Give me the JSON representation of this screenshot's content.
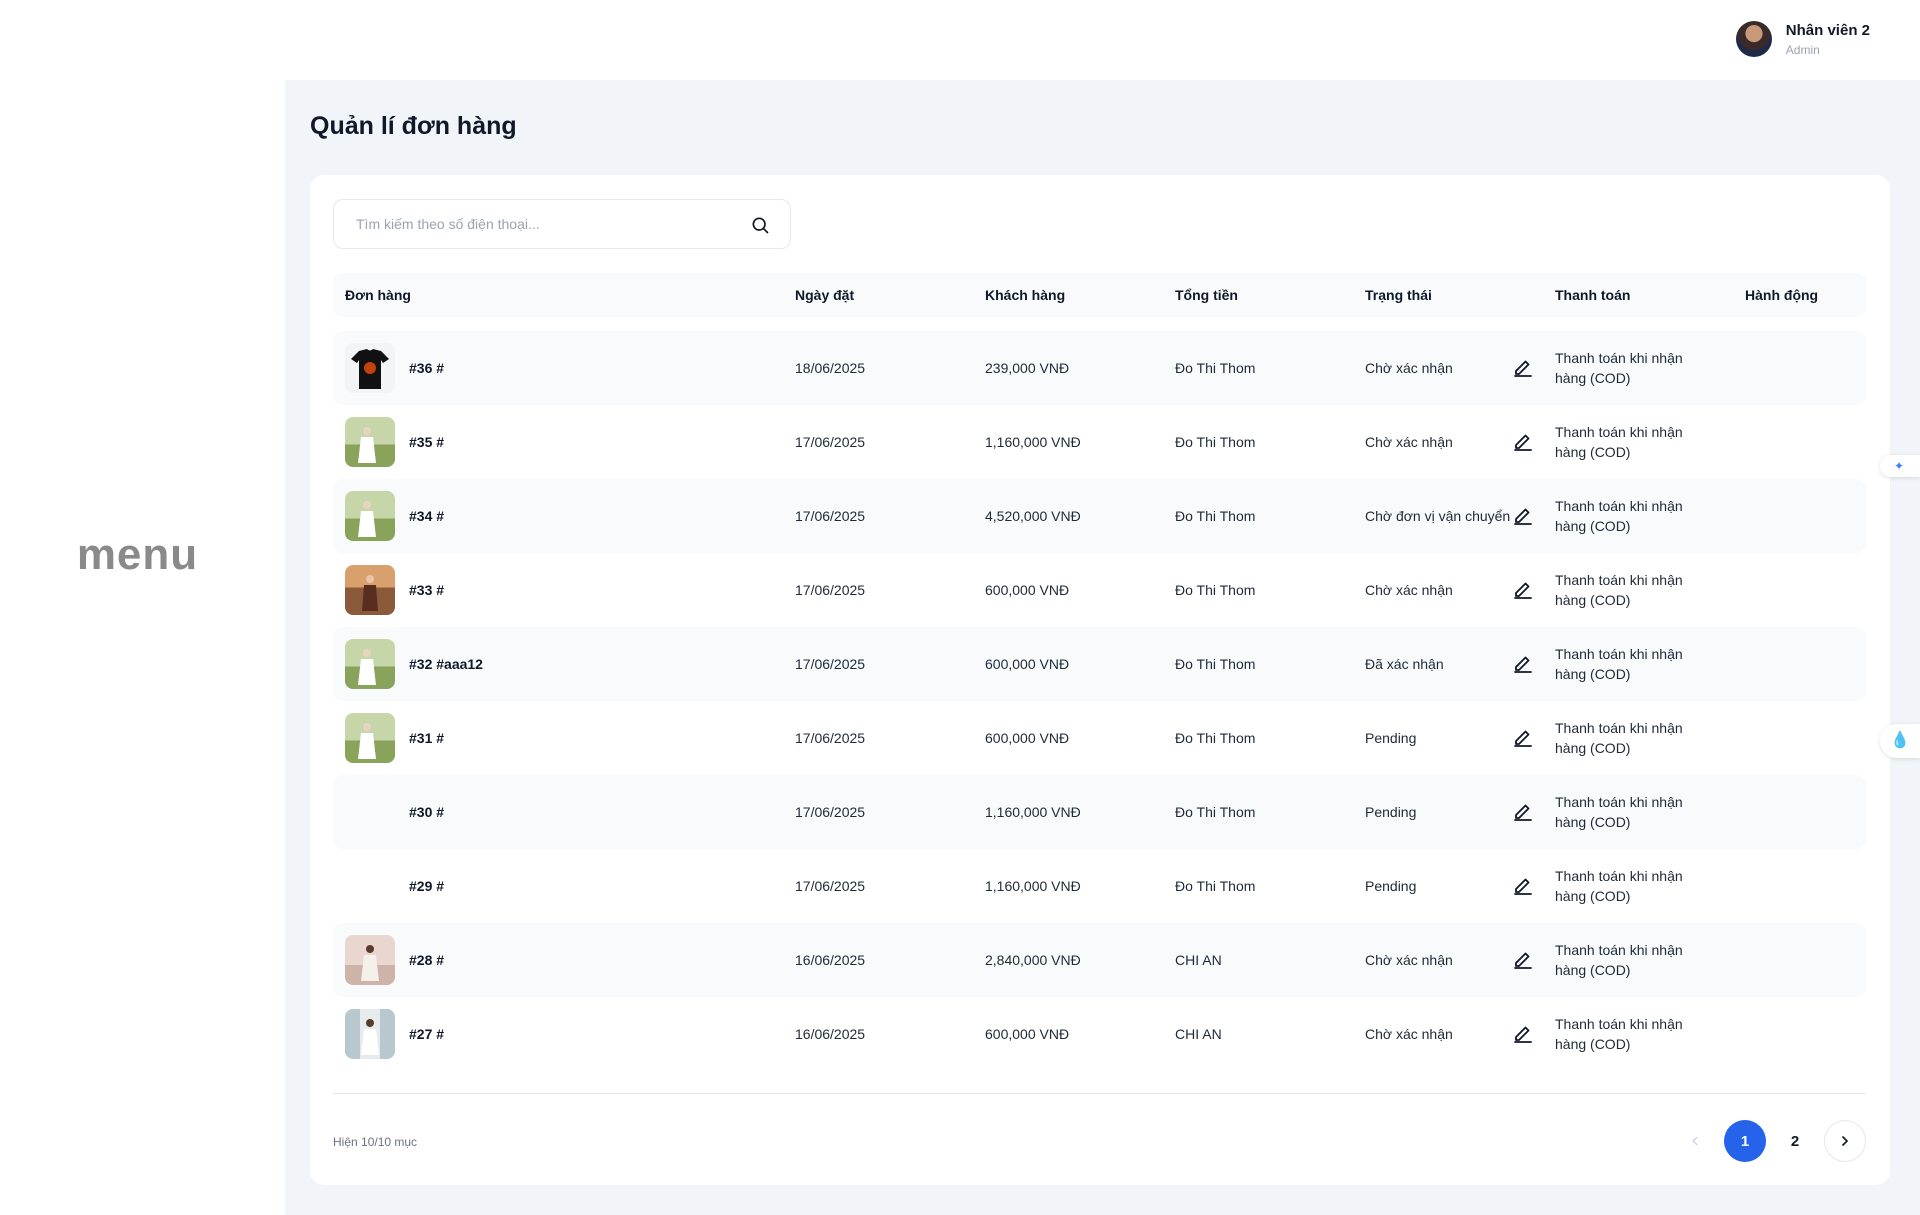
{
  "header": {
    "user_name": "Nhân viên 2",
    "user_role": "Admin"
  },
  "sidebar": {
    "label": "menu"
  },
  "page": {
    "title": "Quản lí đơn hàng"
  },
  "search": {
    "placeholder": "Tìm kiếm theo số điện thoại...",
    "value": ""
  },
  "table": {
    "columns": [
      "Đơn hàng",
      "Ngày đặt",
      "Khách hàng",
      "Tổng tiền",
      "Trạng thái",
      "Thanh toán",
      "Hành động"
    ],
    "rows": [
      {
        "id": "#36 #",
        "date": "18/06/2025",
        "customer": "Đo Thi Thom",
        "total": "239,000 VNĐ",
        "status": "Chờ xác nhận",
        "payment": "Thanh toán khi nhận hàng (COD)"
      },
      {
        "id": "#35 #",
        "date": "17/06/2025",
        "customer": "Đo Thi Thom",
        "total": "1,160,000 VNĐ",
        "status": "Chờ xác nhận",
        "payment": "Thanh toán khi nhận hàng (COD)"
      },
      {
        "id": "#34 #",
        "date": "17/06/2025",
        "customer": "Đo Thi Thom",
        "total": "4,520,000 VNĐ",
        "status": "Chờ đơn vị vận chuyển",
        "payment": "Thanh toán khi nhận hàng (COD)"
      },
      {
        "id": "#33 #",
        "date": "17/06/2025",
        "customer": "Đo Thi Thom",
        "total": "600,000 VNĐ",
        "status": "Chờ xác nhận",
        "payment": "Thanh toán khi nhận hàng (COD)"
      },
      {
        "id": "#32 #aaa12",
        "date": "17/06/2025",
        "customer": "Đo Thi Thom",
        "total": "600,000 VNĐ",
        "status": "Đã xác nhận",
        "payment": "Thanh toán khi nhận hàng (COD)"
      },
      {
        "id": "#31 #",
        "date": "17/06/2025",
        "customer": "Đo Thi Thom",
        "total": "600,000 VNĐ",
        "status": "Pending",
        "payment": "Thanh toán khi nhận hàng (COD)"
      },
      {
        "id": "#30 #",
        "date": "17/06/2025",
        "customer": "Đo Thi Thom",
        "total": "1,160,000 VNĐ",
        "status": "Pending",
        "payment": "Thanh toán khi nhận hàng (COD)"
      },
      {
        "id": "#29 #",
        "date": "17/06/2025",
        "customer": "Đo Thi Thom",
        "total": "1,160,000 VNĐ",
        "status": "Pending",
        "payment": "Thanh toán khi nhận hàng (COD)"
      },
      {
        "id": "#28 #",
        "date": "16/06/2025",
        "customer": "CHI AN",
        "total": "2,840,000 VNĐ",
        "status": "Chờ xác nhận",
        "payment": "Thanh toán khi nhận hàng (COD)"
      },
      {
        "id": "#27 #",
        "date": "16/06/2025",
        "customer": "CHI AN",
        "total": "600,000 VNĐ",
        "status": "Chờ xác nhận",
        "payment": "Thanh toán khi nhận hàng (COD)"
      }
    ]
  },
  "footer": {
    "info": "Hiện 10/10 mục"
  },
  "pagination": {
    "pages": [
      "1",
      "2"
    ],
    "current": "1"
  },
  "icons": {
    "search": "search-icon",
    "edit": "pencil-icon",
    "prev": "chevron-left-icon",
    "next": "chevron-right-icon"
  },
  "colors": {
    "accent": "#2563eb",
    "background": "#f1f5f9"
  }
}
